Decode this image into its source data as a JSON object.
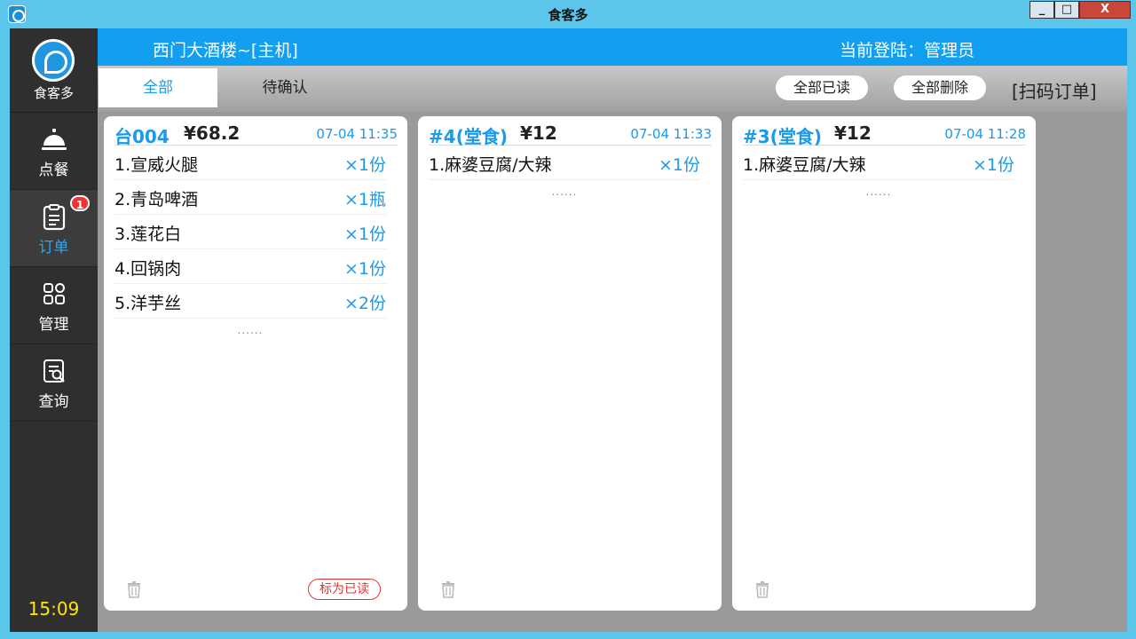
{
  "window": {
    "title": "食客多",
    "min_label": "_",
    "max_label": "□",
    "close_label": "X"
  },
  "sidebar": {
    "logo_text": "食客多",
    "items": [
      {
        "label": "点餐",
        "icon": "cloche-icon"
      },
      {
        "label": "订单",
        "icon": "clipboard-icon",
        "badge": "1"
      },
      {
        "label": "管理",
        "icon": "grid-icon"
      },
      {
        "label": "查询",
        "icon": "search-doc-icon"
      }
    ],
    "clock": "15:09"
  },
  "header": {
    "store_name": "西门大酒楼~[主机]",
    "login_info": "当前登陆：管理员"
  },
  "toolbar": {
    "tabs": [
      {
        "label": "全部",
        "active": true
      },
      {
        "label": "待确认",
        "active": false
      }
    ],
    "mark_all_read": "全部已读",
    "delete_all": "全部删除",
    "scan_order": "[扫码订单]"
  },
  "orders": [
    {
      "no": "台004",
      "total": "¥68.2",
      "time": "07-04 11:35",
      "items": [
        {
          "name": "1.宣威火腿",
          "qty": "×1份"
        },
        {
          "name": "2.青岛啤酒",
          "qty": "×1瓶"
        },
        {
          "name": "3.莲花白",
          "qty": "×1份"
        },
        {
          "name": "4.回锅肉",
          "qty": "×1份"
        },
        {
          "name": "5.洋芋丝",
          "qty": "×2份"
        }
      ],
      "more": "......",
      "mark_read": "标为已读"
    },
    {
      "no": "#4(堂食)",
      "total": "¥12",
      "time": "07-04 11:33",
      "items": [
        {
          "name": "1.麻婆豆腐/大辣",
          "qty": "×1份"
        }
      ],
      "more": "......"
    },
    {
      "no": "#3(堂食)",
      "total": "¥12",
      "time": "07-04 11:28",
      "items": [
        {
          "name": "1.麻婆豆腐/大辣",
          "qty": "×1份"
        }
      ],
      "more": "......"
    }
  ],
  "colors": {
    "accent": "#139ff0",
    "sidebar_bg": "#2f2f2f",
    "badge": "#e33333",
    "clock": "#ffe600"
  }
}
